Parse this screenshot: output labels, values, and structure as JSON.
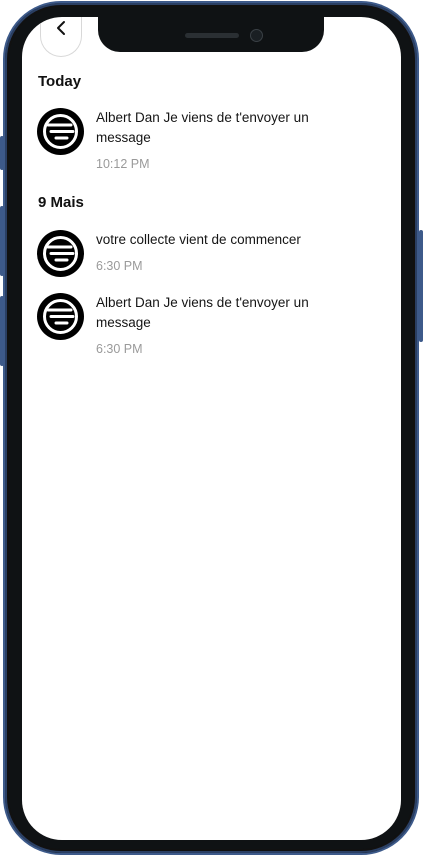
{
  "sections": [
    {
      "title": "Today",
      "notifications": [
        {
          "message": "Albert Dan Je viens de t'envoyer un message",
          "time": "10:12 PM"
        }
      ]
    },
    {
      "title": "9 Mais",
      "notifications": [
        {
          "message": "votre collecte vient de commencer",
          "time": "6:30 PM"
        },
        {
          "message": "Albert Dan Je viens de t'envoyer un message",
          "time": "6:30 PM"
        }
      ]
    }
  ],
  "icons": {
    "back": "chevron-left-icon",
    "avatar": "app-logo-icon"
  },
  "colors": {
    "frame_accent": "#3d5a8a",
    "avatar_bg": "#000000",
    "time_text": "#9a9a9a"
  }
}
